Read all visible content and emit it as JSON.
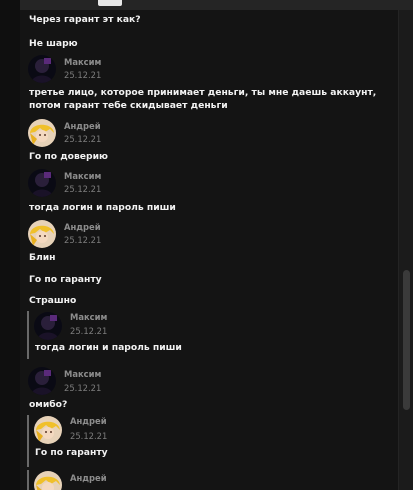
{
  "header": {
    "active_tab": ""
  },
  "messages": [
    {
      "text": "Через гарант эт как?"
    },
    {
      "text": "Не шарю"
    },
    {
      "author": "Максим",
      "date": "25.12.21",
      "text": "третье лицо, которое принимает деньги, ты мне даешь аккаунт, потом гарант тебе скидывает деньги"
    },
    {
      "author": "Андрей",
      "date": "25.12.21",
      "text": "Го по доверию"
    },
    {
      "author": "Максим",
      "date": "25.12.21",
      "text": "тогда логин и пароль пиши"
    },
    {
      "author": "Андрей",
      "date": "25.12.21",
      "texts": [
        "Блин",
        "Го по гаранту",
        "Страшно"
      ]
    },
    {
      "quote": {
        "author": "Максим",
        "date": "25.12.21",
        "text": "тогда логин и пароль пиши"
      }
    },
    {
      "author": "Максим",
      "date": "25.12.21",
      "text": "омибо?"
    },
    {
      "quote": {
        "author": "Андрей",
        "date": "25.12.21",
        "text": "Го по гаранту"
      }
    },
    {
      "author": "Андрей",
      "date": ""
    }
  ],
  "colors": {
    "background": "#141414",
    "text": "#f2f2f2",
    "author": "#8d8d8d",
    "date": "#7c7c7c",
    "quote_bar": "#6a6a6a"
  },
  "icons": {
    "avatar_maxim": "dark-figure-avatar",
    "avatar_andrey": "anime-blonde-avatar"
  }
}
